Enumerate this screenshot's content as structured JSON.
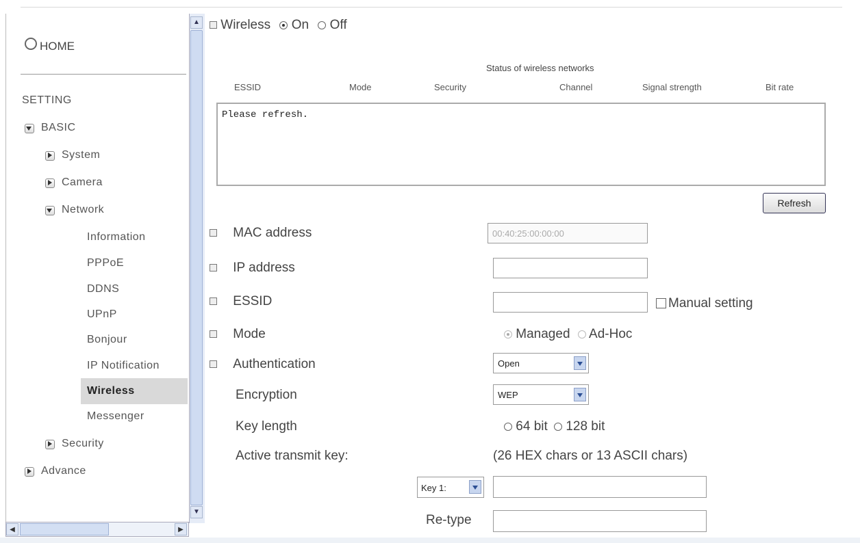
{
  "sidebar": {
    "home": "HOME",
    "setting": "SETTING",
    "basic": "BASIC",
    "system": "System",
    "camera": "Camera",
    "network": "Network",
    "network_items": [
      "Information",
      "PPPoE",
      "DDNS",
      "UPnP",
      "Bonjour",
      "IP Notification",
      "Wireless",
      "Messenger"
    ],
    "security": "Security",
    "advance": "Advance"
  },
  "wireless": {
    "label": "Wireless",
    "on": "On",
    "off": "Off",
    "selected": "On"
  },
  "status": {
    "title": "Status of wireless networks",
    "columns": [
      "ESSID",
      "Mode",
      "Security",
      "Channel",
      "Signal strength",
      "Bit rate"
    ],
    "message": "Please refresh.",
    "refresh_label": "Refresh"
  },
  "form": {
    "mac_label": "MAC address",
    "mac_value": "00:40:25:00:00:00",
    "ip_label": "IP address",
    "ip_value": "",
    "essid_label": "ESSID",
    "essid_value": "",
    "manual_label": "Manual setting",
    "mode_label": "Mode",
    "mode_managed": "Managed",
    "mode_adhoc": "Ad-Hoc",
    "mode_selected": "Managed",
    "auth_label": "Authentication",
    "auth_value": "Open",
    "enc_label": "Encryption",
    "enc_value": "WEP",
    "keylen_label": "Key length",
    "keylen_64": "64 bit",
    "keylen_128": "128 bit",
    "active_key_label": "Active transmit key:",
    "key_hint": "(26 HEX chars or 13 ASCII chars)",
    "key_select": "Key 1:",
    "key_value": "",
    "retype_label": "Re-type",
    "retype_value": ""
  }
}
